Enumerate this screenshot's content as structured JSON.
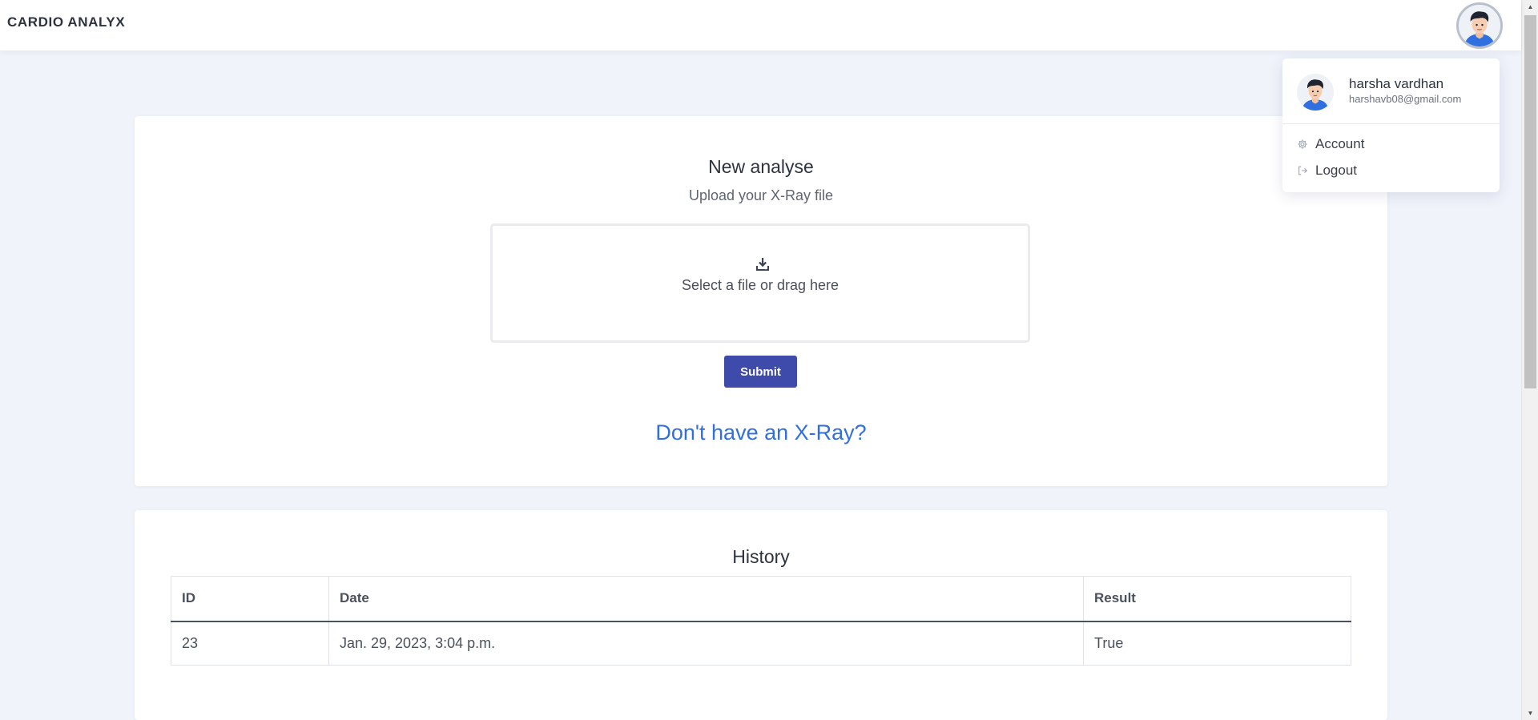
{
  "header": {
    "brand": "CARDIO ANALYX",
    "avatar_icon": "user-avatar-icon"
  },
  "account_menu": {
    "name": "harsha vardhan",
    "email": "harshavb08@gmail.com",
    "items": [
      {
        "label": "Account",
        "icon": "gear-icon"
      },
      {
        "label": "Logout",
        "icon": "logout-icon"
      }
    ]
  },
  "upload": {
    "title": "New analyse",
    "subtitle": "Upload your X-Ray file",
    "dropzone_text": "Select a file or drag here",
    "dropzone_icon": "download-tray-icon",
    "submit_label": "Submit",
    "no_xray_link": "Don't have an X-Ray?"
  },
  "history": {
    "title": "History",
    "columns": [
      "ID",
      "Date",
      "Result"
    ],
    "rows": [
      [
        "23",
        "Jan. 29, 2023, 3:04 p.m.",
        "True"
      ]
    ]
  },
  "colors": {
    "accent": "#3e4bab",
    "link": "#2f6fe0",
    "background": "#f0f3fa"
  }
}
